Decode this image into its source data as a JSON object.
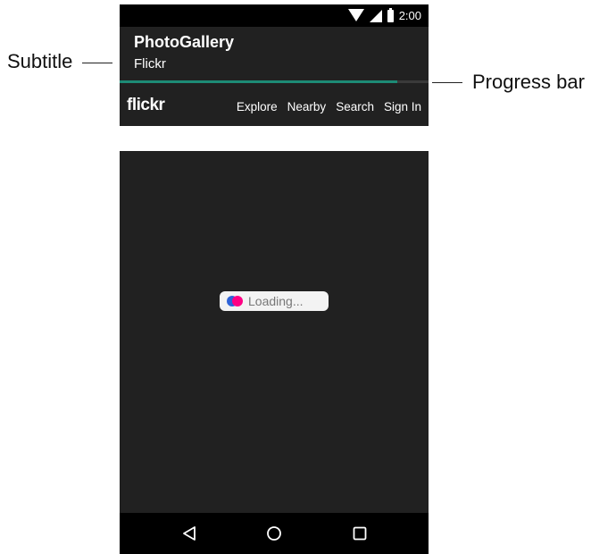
{
  "callouts": {
    "subtitle": "Subtitle",
    "progress_bar": "Progress bar"
  },
  "status_bar": {
    "time": "2:00",
    "icons": [
      "wifi-icon",
      "signal-icon",
      "battery-icon"
    ]
  },
  "app_bar": {
    "title": "PhotoGallery",
    "subtitle": "Flickr"
  },
  "progress": {
    "fraction": 0.9,
    "color": "#1d8b76"
  },
  "web_page": {
    "logo": "flickr",
    "nav_links": [
      "Explore",
      "Nearby",
      "Search",
      "Sign In"
    ],
    "loading_text": "Loading..."
  },
  "nav_bar": {
    "buttons": [
      "back-icon",
      "home-icon",
      "recent-apps-icon"
    ]
  },
  "colors": {
    "background": "#212121",
    "status_bar": "#000000",
    "loader_blue": "#2e63d8",
    "loader_pink": "#ff0084"
  }
}
